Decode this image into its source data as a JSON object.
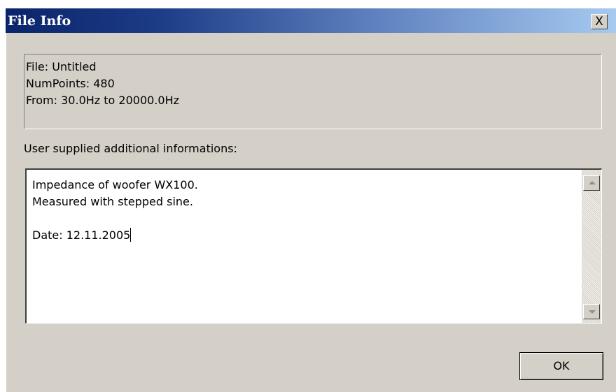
{
  "window": {
    "title": "File Info",
    "close_label": "X"
  },
  "file_info": {
    "lines": [
      "File: Untitled",
      "NumPoints: 480",
      "From: 30.0Hz to 20000.0Hz"
    ]
  },
  "notes": {
    "label": "User supplied additional informations:",
    "lines": [
      "Impedance of woofer WX100.",
      "Measured with stepped sine.",
      "",
      "Date: 12.11.2005"
    ]
  },
  "buttons": {
    "ok_label": "OK"
  },
  "colors": {
    "dialog_face": "#d4d0c8",
    "title_gradient_start": "#0a246a",
    "title_gradient_end": "#a6caf0",
    "title_text": "#ffffff"
  },
  "icons": {
    "scroll_up": "arrow-up-icon",
    "scroll_down": "arrow-down-icon"
  }
}
